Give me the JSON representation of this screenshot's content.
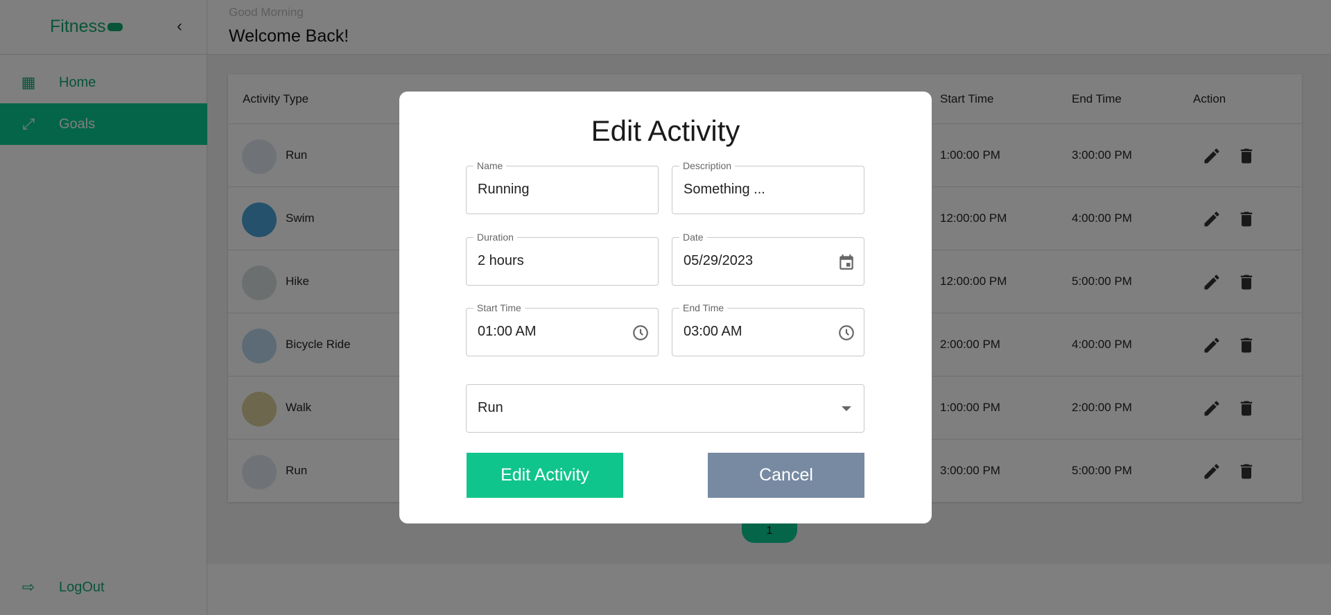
{
  "sidebar": {
    "brand": "Fitness",
    "items": [
      {
        "label": "Home",
        "icon": "grid-icon"
      },
      {
        "label": "Goals",
        "icon": "dumbbell-icon",
        "active": true
      }
    ],
    "logout": "LogOut"
  },
  "header": {
    "greeting": "Good Morning",
    "title": "Welcome Back!"
  },
  "table": {
    "columns": {
      "activity_type": "Activity Type",
      "start_time": "Start Time",
      "end_time": "End Time",
      "action": "Action"
    },
    "rows": [
      {
        "type": "Run",
        "start": "1:00:00 PM",
        "end": "3:00:00 PM"
      },
      {
        "type": "Swim",
        "start": "12:00:00 PM",
        "end": "4:00:00 PM"
      },
      {
        "type": "Hike",
        "start": "12:00:00 PM",
        "end": "5:00:00 PM"
      },
      {
        "type": "Bicycle Ride",
        "start": "2:00:00 PM",
        "end": "4:00:00 PM"
      },
      {
        "type": "Walk",
        "start": "1:00:00 PM",
        "end": "2:00:00 PM"
      },
      {
        "type": "Run",
        "start": "3:00:00 PM",
        "end": "5:00:00 PM"
      }
    ]
  },
  "pagination": {
    "current": "1"
  },
  "modal": {
    "title": "Edit Activity",
    "fields": {
      "name": {
        "label": "Name",
        "value": "Running"
      },
      "description": {
        "label": "Description",
        "value": "Something ..."
      },
      "duration": {
        "label": "Duration",
        "value": "2 hours"
      },
      "date": {
        "label": "Date",
        "value": "05/29/2023"
      },
      "start_time": {
        "label": "Start Time",
        "value": "01:00 AM"
      },
      "end_time": {
        "label": "End Time",
        "value": "03:00 AM"
      }
    },
    "activity_select": {
      "value": "Run"
    },
    "submit_label": "Edit Activity",
    "cancel_label": "Cancel"
  },
  "colors": {
    "brand": "#0aca90",
    "submit": "#10c58b",
    "cancel": "#778aa2"
  }
}
